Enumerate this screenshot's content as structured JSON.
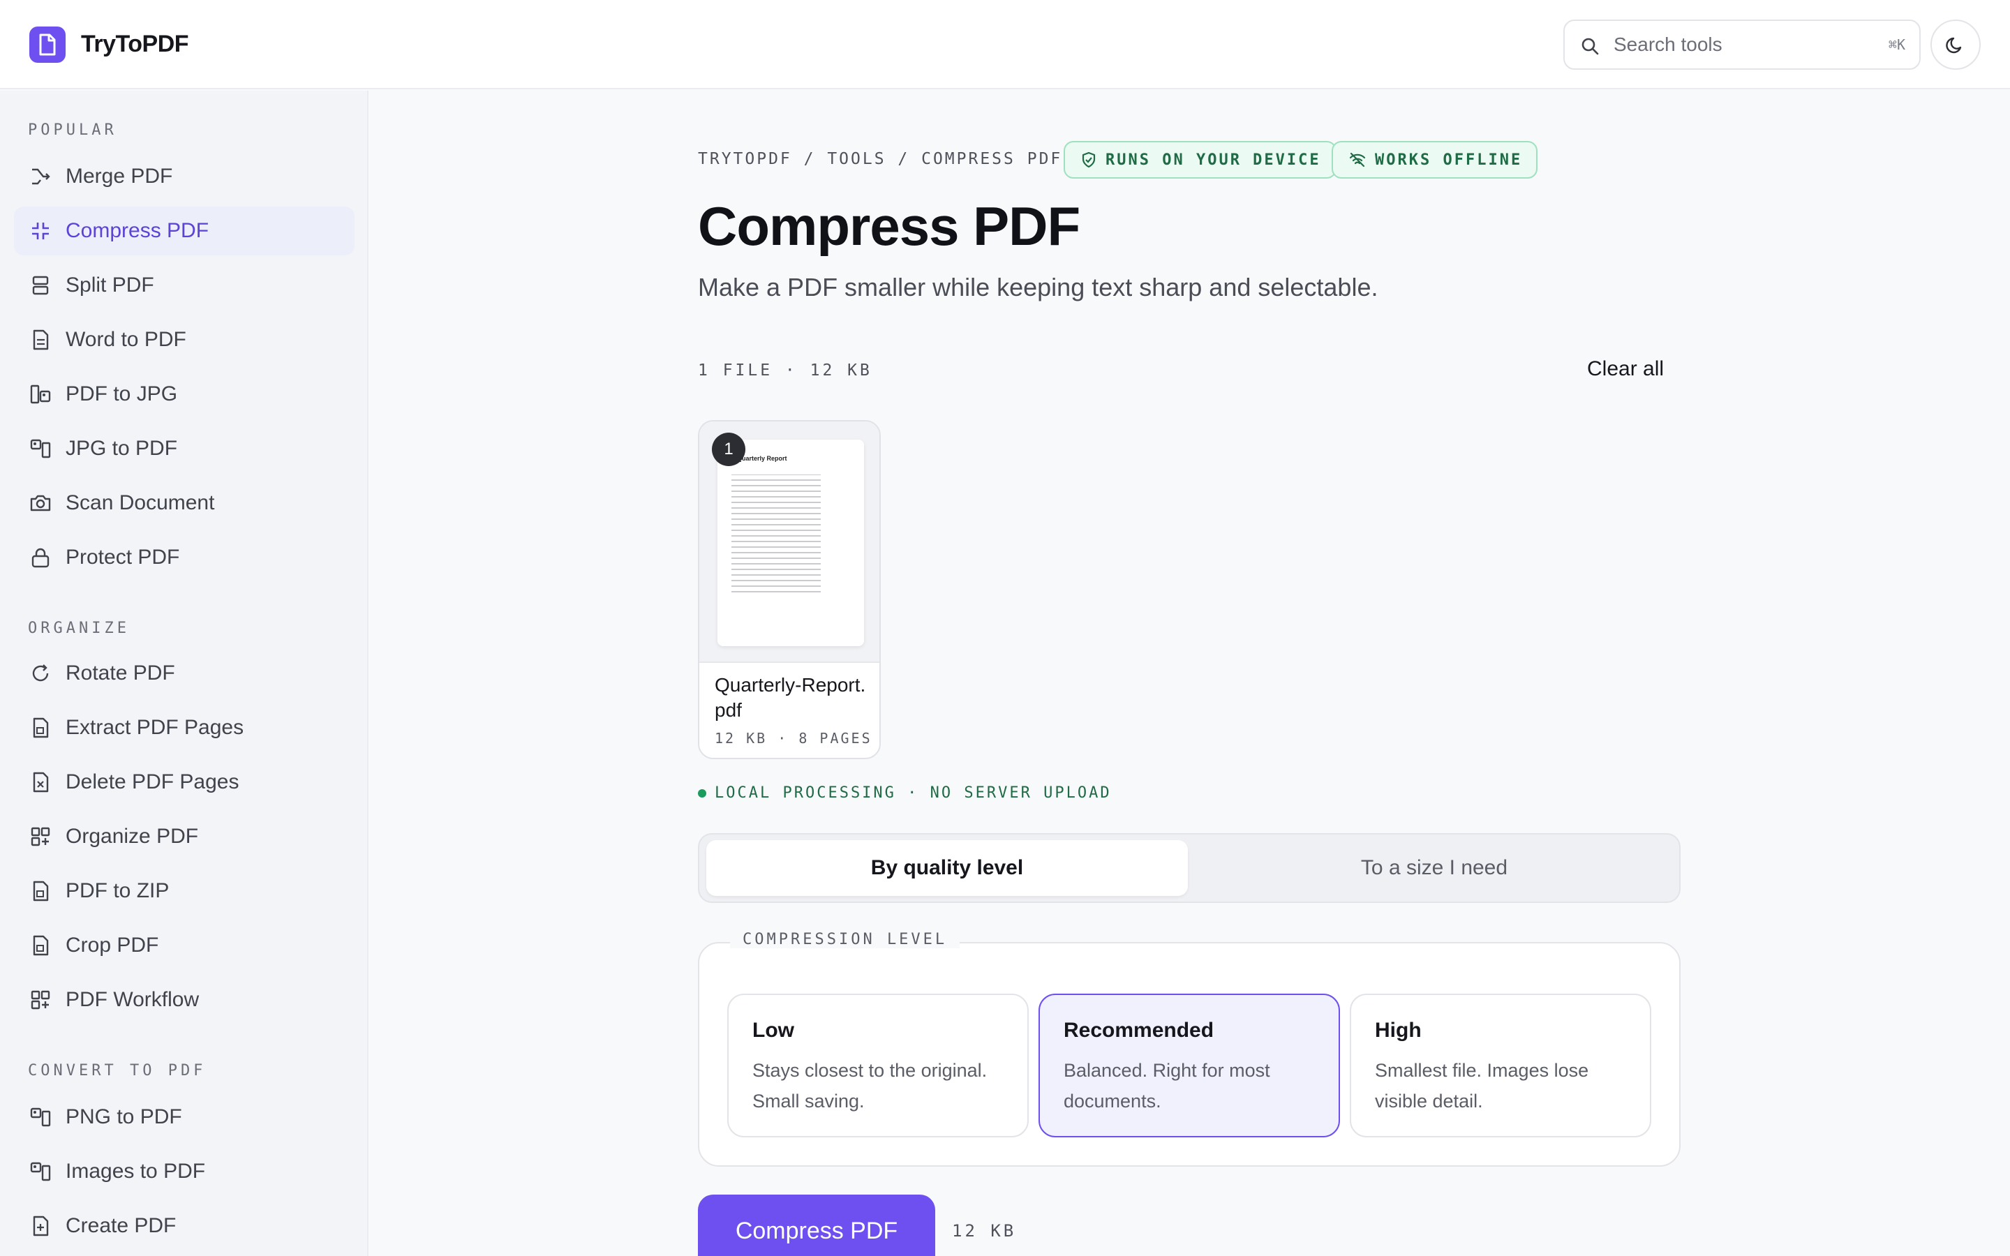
{
  "header": {
    "brand": "TryToPDF",
    "search_placeholder": "Search tools",
    "search_shortcut": "⌘K"
  },
  "sidebar": {
    "sections": [
      {
        "title": "POPULAR",
        "items": [
          {
            "label": "Merge PDF",
            "icon": "merge-icon"
          },
          {
            "label": "Compress PDF",
            "icon": "compress-icon",
            "active": true
          },
          {
            "label": "Split PDF",
            "icon": "split-icon"
          },
          {
            "label": "Word to PDF",
            "icon": "document-icon"
          },
          {
            "label": "PDF to JPG",
            "icon": "image-icon"
          },
          {
            "label": "JPG to PDF",
            "icon": "image-to-pdf-icon"
          },
          {
            "label": "Scan Document",
            "icon": "camera-icon"
          },
          {
            "label": "Protect PDF",
            "icon": "lock-icon"
          }
        ]
      },
      {
        "title": "ORGANIZE",
        "items": [
          {
            "label": "Rotate PDF",
            "icon": "rotate-icon"
          },
          {
            "label": "Extract PDF Pages",
            "icon": "extract-icon"
          },
          {
            "label": "Delete PDF Pages",
            "icon": "delete-page-icon"
          },
          {
            "label": "Organize PDF",
            "icon": "grid-plus-icon"
          },
          {
            "label": "PDF to ZIP",
            "icon": "zip-icon"
          },
          {
            "label": "Crop PDF",
            "icon": "crop-icon"
          },
          {
            "label": "PDF Workflow",
            "icon": "workflow-icon"
          }
        ]
      },
      {
        "title": "CONVERT TO PDF",
        "items": [
          {
            "label": "PNG to PDF",
            "icon": "image-to-pdf-icon"
          },
          {
            "label": "Images to PDF",
            "icon": "image-to-pdf-icon"
          },
          {
            "label": "Create PDF",
            "icon": "create-icon"
          }
        ]
      }
    ]
  },
  "main": {
    "breadcrumb": "TRYTOPDF / TOOLS / COMPRESS PDF",
    "badges": [
      "RUNS ON YOUR DEVICE",
      "WORKS OFFLINE"
    ],
    "title": "Compress PDF",
    "subtitle": "Make a PDF smaller while keeping text sharp and selectable.",
    "file_count": "1 FILE · 12 KB",
    "clear_all": "Clear all",
    "file": {
      "index": "1",
      "thumb_title": "Quarterly Report",
      "name": "Quarterly-Report.pdf",
      "meta": "12 KB · 8 PAGES"
    },
    "local_note": "LOCAL PROCESSING · NO SERVER UPLOAD",
    "modes": [
      "By quality level",
      "To a size I need"
    ],
    "level_legend": "COMPRESSION LEVEL",
    "levels": [
      {
        "name": "Low",
        "desc": "Stays closest to the original. Small saving."
      },
      {
        "name": "Recommended",
        "desc": "Balanced. Right for most documents.",
        "selected": true
      },
      {
        "name": "High",
        "desc": "Smallest file. Images lose visible detail."
      }
    ],
    "cta_label": "Compress PDF",
    "cta_size": "12 KB"
  },
  "colors": {
    "accent": "#6e4ff0",
    "success": "#1c9b5e"
  }
}
